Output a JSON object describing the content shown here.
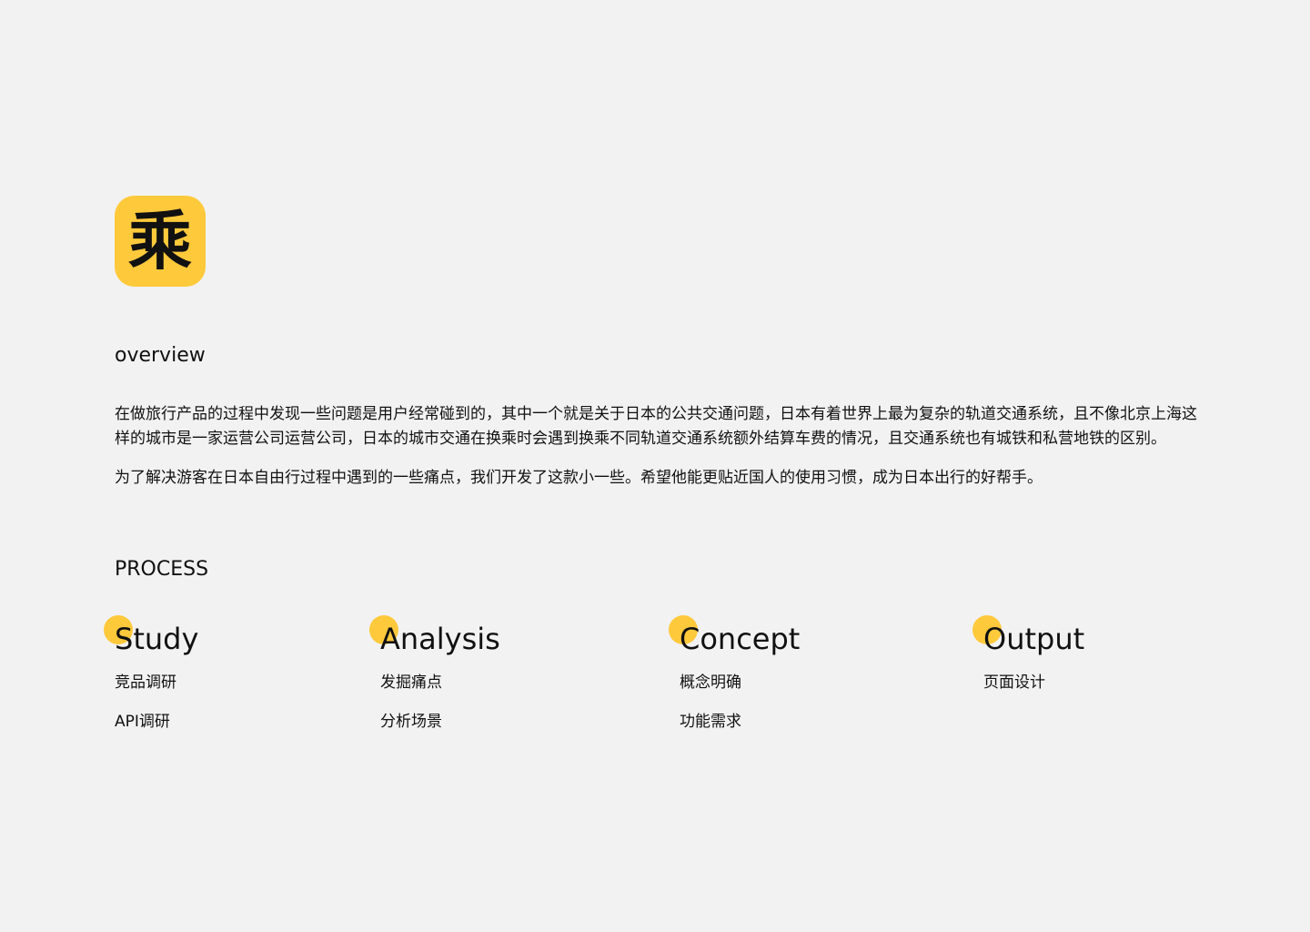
{
  "app": {
    "icon_glyph": "乘",
    "icon_name": "cheng-logo-icon"
  },
  "overview": {
    "heading": "overview",
    "paragraphs": [
      "在做旅行产品的过程中发现一些问题是用户经常碰到的，其中一个就是关于日本的公共交通问题，日本有着世界上最为复杂的轨道交通系统，且不像北京上海这样的城市是一家运营公司运营公司，日本的城市交通在换乘时会遇到换乘不同轨道交通系统额外结算车费的情况，且交通系统也有城铁和私营地铁的区别。",
      "为了解决游客在日本自由行过程中遇到的一些痛点，我们开发了这款小一些。希望他能更贴近国人的使用习惯，成为日本出行的好帮手。"
    ]
  },
  "process": {
    "heading": "PROCESS",
    "steps": [
      {
        "title": "Study",
        "items": [
          "竞品调研",
          "API调研"
        ]
      },
      {
        "title": "Analysis",
        "items": [
          "发掘痛点",
          "分析场景"
        ]
      },
      {
        "title": "Concept",
        "items": [
          "概念明确",
          "功能需求"
        ]
      },
      {
        "title": "Output",
        "items": [
          "页面设计"
        ]
      }
    ]
  },
  "colors": {
    "background": "#f2f2f2",
    "accent": "#ffc93c",
    "text": "#111111"
  }
}
